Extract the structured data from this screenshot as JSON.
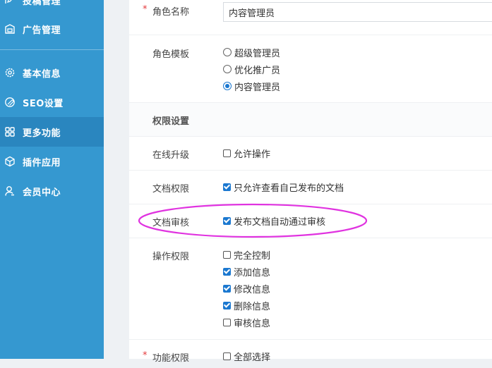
{
  "sidebar": {
    "items": [
      {
        "label": "投稿管理"
      },
      {
        "label": "广告管理"
      },
      {
        "label": "基本信息"
      },
      {
        "label": "SEO设置"
      },
      {
        "label": "更多功能"
      },
      {
        "label": "插件应用"
      },
      {
        "label": "会员中心"
      }
    ]
  },
  "form": {
    "role_name": {
      "label": "角色名称",
      "value": "内容管理员"
    },
    "role_template": {
      "label": "角色模板",
      "options": [
        "超级管理员",
        "优化推广员",
        "内容管理员"
      ],
      "selected": "内容管理员"
    },
    "permission_section": "权限设置",
    "online_upgrade": {
      "label": "在线升级",
      "option": "允许操作",
      "checked": false
    },
    "doc_permission": {
      "label": "文档权限",
      "option": "只允许查看自己发布的文档",
      "checked": true
    },
    "doc_review": {
      "label": "文档审核",
      "option": "发布文档自动通过审核",
      "checked": true
    },
    "operation_permission": {
      "label": "操作权限",
      "options": [
        {
          "label": "完全控制",
          "checked": false
        },
        {
          "label": "添加信息",
          "checked": true
        },
        {
          "label": "修改信息",
          "checked": true
        },
        {
          "label": "删除信息",
          "checked": true
        },
        {
          "label": "审核信息",
          "checked": false
        }
      ]
    },
    "feature_permission": {
      "label": "功能权限",
      "option": "全部选择",
      "checked": false
    }
  },
  "colors": {
    "sidebar_bg": "#3598d0",
    "sidebar_active": "#2a86bf",
    "checkbox_checked": "#1b78d0",
    "required_mark": "#e4393c",
    "annotation": "#e033e0"
  }
}
